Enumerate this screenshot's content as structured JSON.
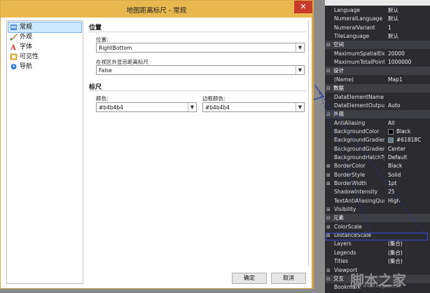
{
  "dialog": {
    "title": "地图距离标尺 - 常规",
    "close": "✕",
    "nav": [
      {
        "label": "常规",
        "icon": "general-icon",
        "selected": true
      },
      {
        "label": "外观",
        "icon": "brush-icon"
      },
      {
        "label": "字体",
        "icon": "font-icon"
      },
      {
        "label": "可见性",
        "icon": "visibility-icon"
      },
      {
        "label": "导航",
        "icon": "navigation-icon"
      }
    ],
    "position_section": "位置",
    "position_label": "位置:",
    "position_value": "RightBottom",
    "outside_label": "在视区外显示距离标尺",
    "outside_value": "False",
    "ruler_section": "标尺",
    "color_label": "颜色:",
    "color_value": "#b4b4b4",
    "border_color_label": "边框颜色:",
    "border_color_value": "#b4b4b4",
    "ok": "确定",
    "cancel": "取消"
  },
  "props": {
    "rows": [
      {
        "type": "prop",
        "name": "Language",
        "value": "默认"
      },
      {
        "type": "prop",
        "name": "NumeralLanguage",
        "value": "默认"
      },
      {
        "type": "prop",
        "name": "NumeralVariant",
        "value": "1"
      },
      {
        "type": "prop",
        "name": "TileLanguage",
        "value": "默认"
      },
      {
        "type": "cat",
        "name": "空间",
        "toggle": "⊟"
      },
      {
        "type": "prop",
        "name": "MaximumSpatialEle",
        "value": "20000"
      },
      {
        "type": "prop",
        "name": "MaximumTotalPoint",
        "value": "1000000"
      },
      {
        "type": "cat",
        "name": "设计",
        "toggle": "⊟"
      },
      {
        "type": "prop",
        "name": "(Name)",
        "value": "Map1"
      },
      {
        "type": "cat",
        "name": "数据",
        "toggle": "⊟"
      },
      {
        "type": "prop",
        "name": "DataElementName",
        "value": ""
      },
      {
        "type": "prop",
        "name": "DataElementOutput",
        "value": "Auto"
      },
      {
        "type": "cat",
        "name": "外观",
        "toggle": "⊟"
      },
      {
        "type": "prop",
        "name": "AntiAliasing",
        "value": "All"
      },
      {
        "type": "prop",
        "name": "BackgroundColor",
        "value": "Black",
        "swatch": "#000000"
      },
      {
        "type": "prop",
        "name": "BackgroundGradier",
        "value": "#61818C",
        "swatch": "#61818c"
      },
      {
        "type": "prop",
        "name": "BackgroundGradier",
        "value": "Center"
      },
      {
        "type": "prop",
        "name": "BackgroundHatchTy",
        "value": "Default"
      },
      {
        "type": "prop",
        "name": "BorderColor",
        "value": "Black",
        "toggle": "⊞"
      },
      {
        "type": "prop",
        "name": "BorderStyle",
        "value": "Solid",
        "toggle": "⊞"
      },
      {
        "type": "prop",
        "name": "BorderWidth",
        "value": "1pt",
        "toggle": "⊞"
      },
      {
        "type": "prop",
        "name": "ShadowIntensity",
        "value": "25"
      },
      {
        "type": "prop",
        "name": "TextAntiAliasingQua",
        "value": "High"
      },
      {
        "type": "prop",
        "name": "Visibility",
        "value": "",
        "toggle": "⊞"
      },
      {
        "type": "cat",
        "name": "元素",
        "toggle": "⊟"
      },
      {
        "type": "prop",
        "name": "ColorScale",
        "value": "",
        "toggle": "⊞"
      },
      {
        "type": "prop",
        "name": "DistanceScale",
        "value": "",
        "toggle": "⊞"
      },
      {
        "type": "prop",
        "name": "Layers",
        "value": "(集合)"
      },
      {
        "type": "prop",
        "name": "Legends",
        "value": "(集合)"
      },
      {
        "type": "prop",
        "name": "Titles",
        "value": "(集合)"
      },
      {
        "type": "prop",
        "name": "Viewport",
        "value": "",
        "toggle": "⊞"
      },
      {
        "type": "cat",
        "name": "交互",
        "toggle": "⊟"
      },
      {
        "type": "prop",
        "name": "Bookmark",
        "value": ""
      }
    ]
  },
  "watermark": "脚本之家",
  "watermark_url": "www.evget.com"
}
